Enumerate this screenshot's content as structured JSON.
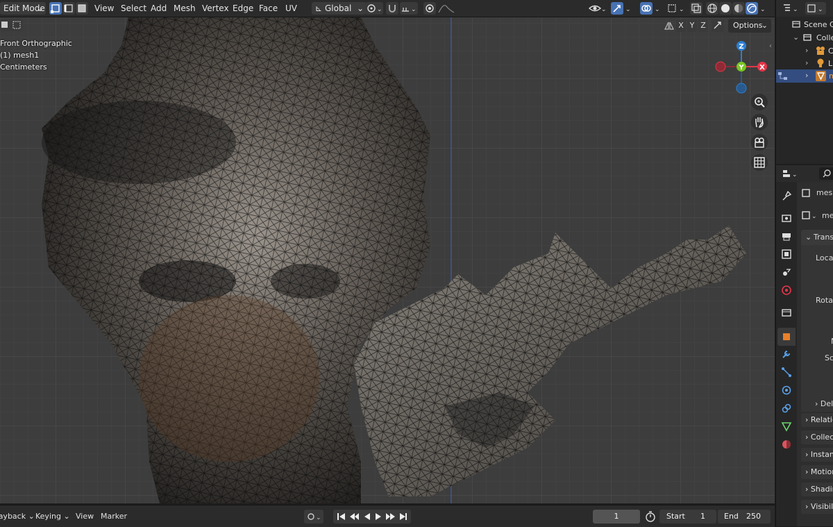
{
  "header": {
    "mode": "Edit Mode",
    "menus": [
      "View",
      "Select",
      "Add",
      "Mesh",
      "Vertex",
      "Edge",
      "Face",
      "UV"
    ],
    "transform_orientation": "Global",
    "options_label": "Options",
    "mirror_axes": [
      "X",
      "Y",
      "Z"
    ]
  },
  "viewport": {
    "view_name": "Front Orthographic",
    "object_label": "(1) mesh1",
    "units": "Centimeters",
    "gizmo": {
      "z": "Z",
      "y": "Y",
      "x": "X"
    }
  },
  "timeline": {
    "playback": "Playback",
    "keying": "Keying",
    "view": "View",
    "marker": "Marker",
    "current_frame": "1",
    "start_label": "Start",
    "start_value": "1",
    "end_label": "End",
    "end_value": "250"
  },
  "outliner": {
    "scene_collection": "Scene Co",
    "collection": "Colle",
    "items": [
      "C",
      "L",
      "m"
    ]
  },
  "properties": {
    "object_name": "mesh",
    "data_name": "me",
    "panels": [
      "Transf",
      "Locat",
      "Rotat",
      "N",
      "Sc",
      "Del",
      "Relatio",
      "Collec",
      "Instan",
      "Motion",
      "Shadin",
      "Visibil"
    ]
  },
  "colors": {
    "accent": "#4772b3",
    "axis_x": "#e5364a",
    "axis_y": "#7ac623",
    "axis_z": "#2d7fd3",
    "header_bg": "#2b2b2b",
    "viewport_bg": "#3d3d3d"
  }
}
